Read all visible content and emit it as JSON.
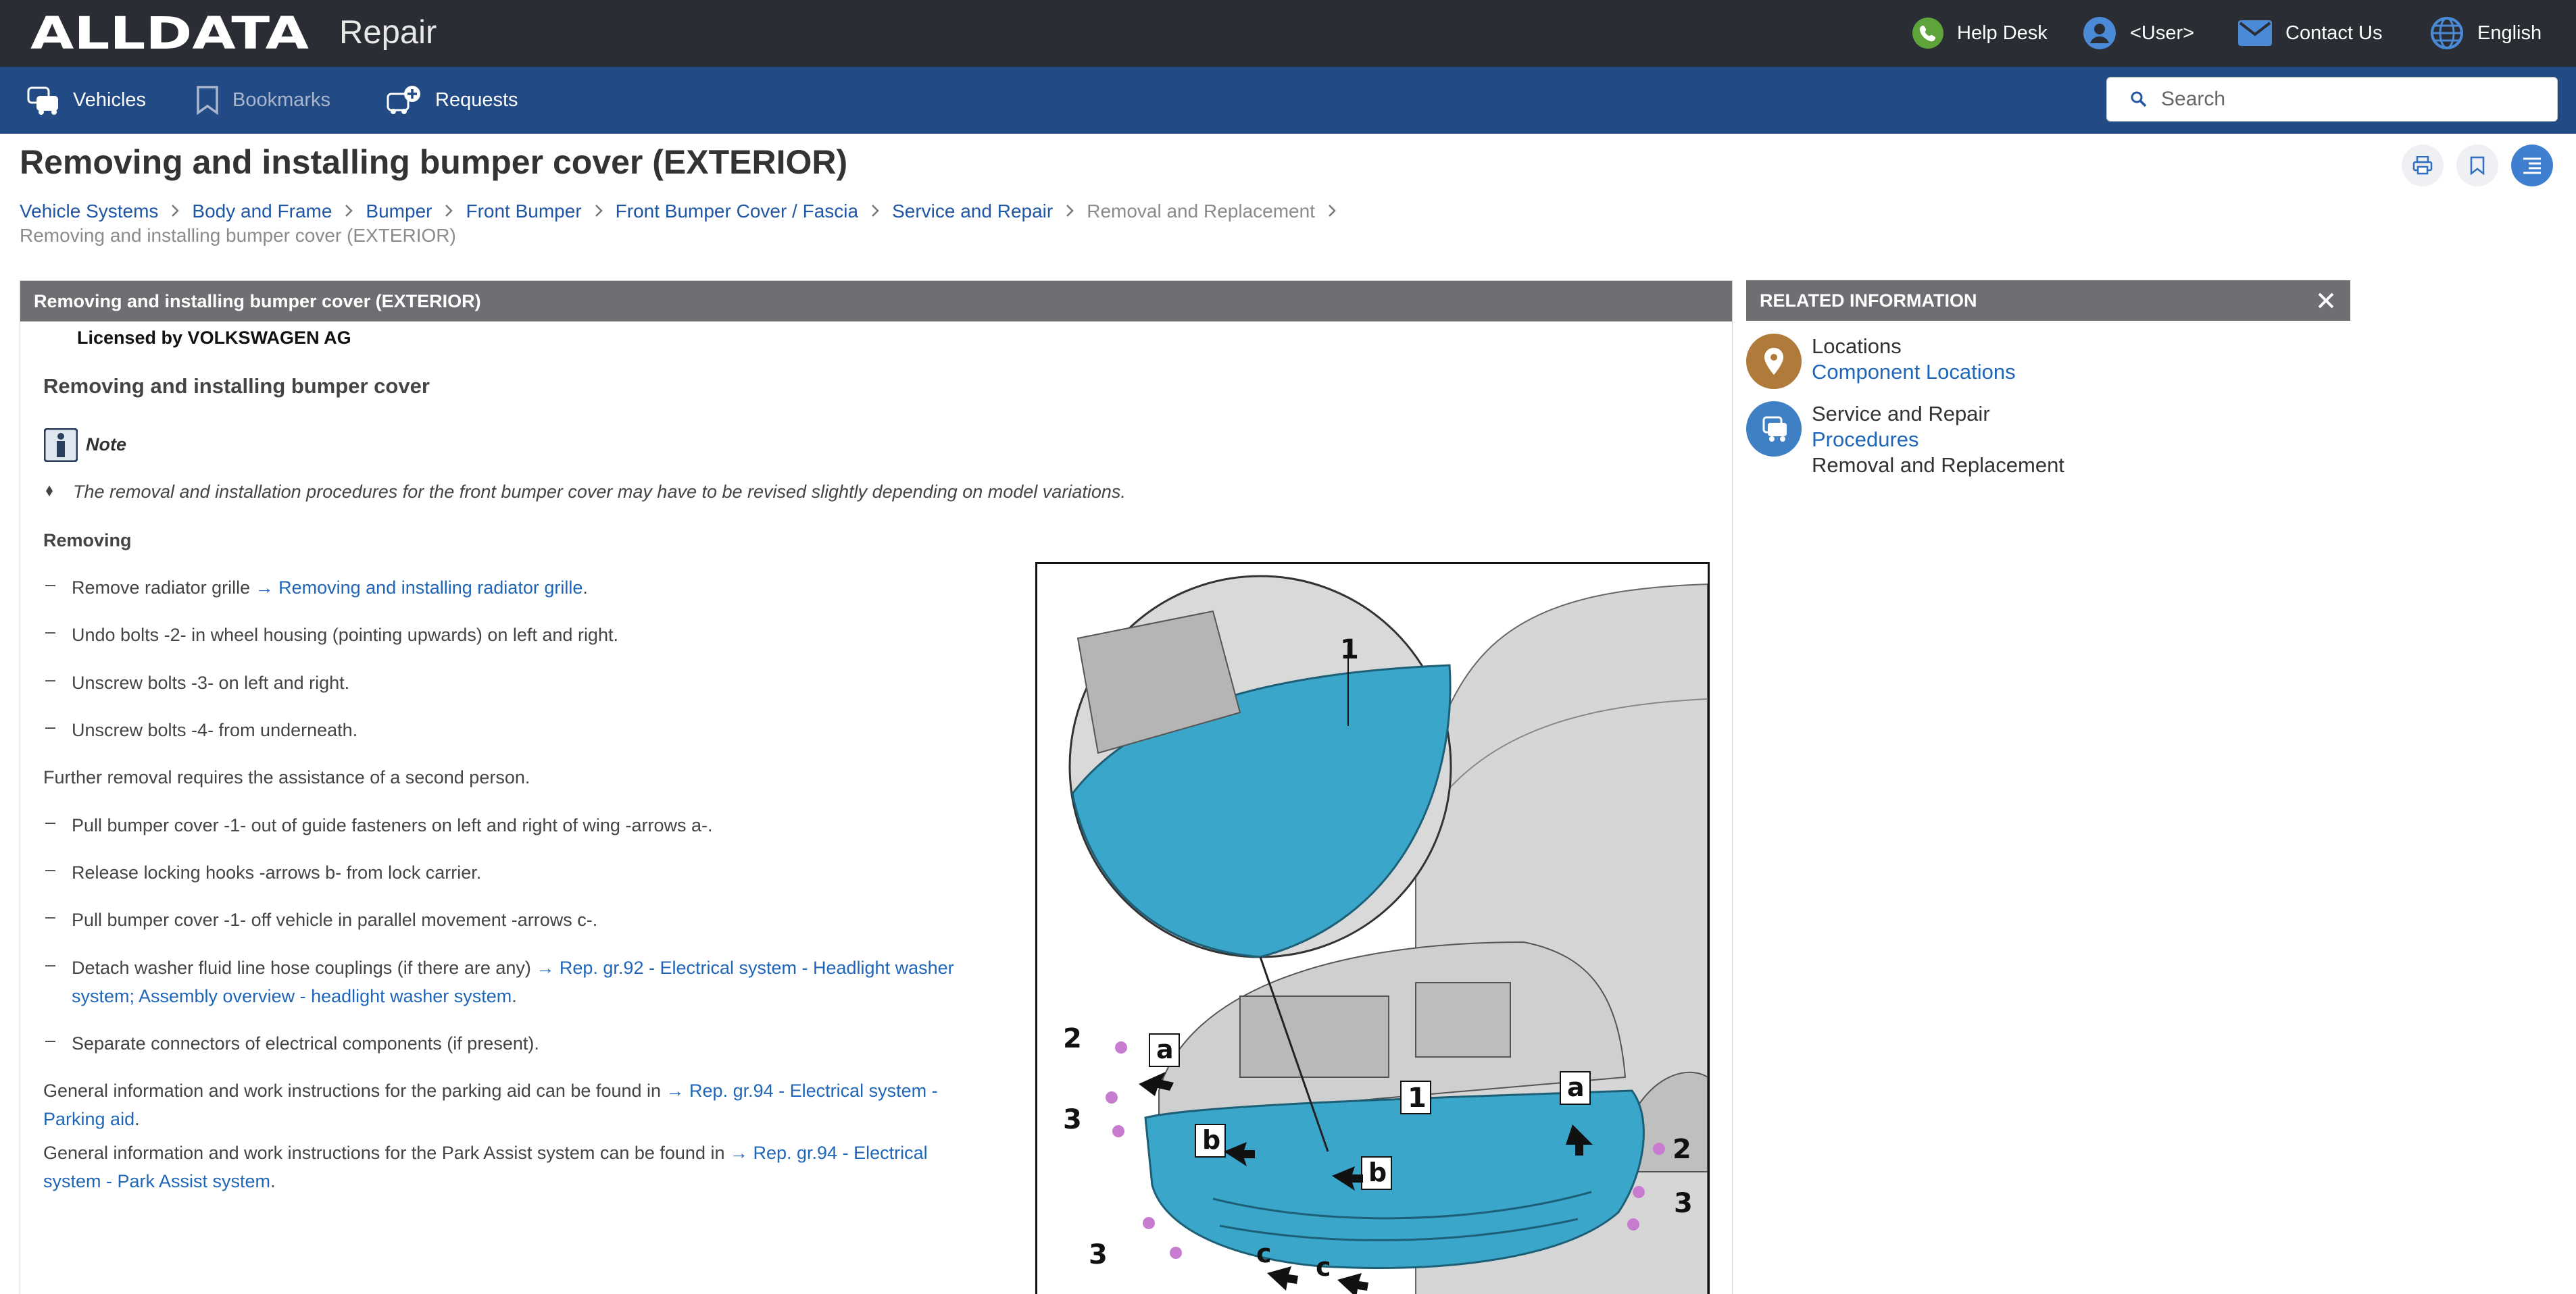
{
  "header": {
    "brand": "ALLDATA",
    "app_title": "Repair",
    "help_desk": "Help Desk",
    "user": "<User>",
    "contact": "Contact Us",
    "language": "English"
  },
  "nav": {
    "vehicles": "Vehicles",
    "bookmarks": "Bookmarks",
    "requests": "Requests",
    "search_placeholder": "Search"
  },
  "page": {
    "title": "Removing and installing bumper cover (EXTERIOR)"
  },
  "breadcrumb": [
    {
      "label": "Vehicle Systems"
    },
    {
      "label": "Body and Frame"
    },
    {
      "label": "Bumper"
    },
    {
      "label": "Front Bumper"
    },
    {
      "label": "Front Bumper Cover / Fascia"
    },
    {
      "label": "Service and Repair"
    },
    {
      "label": "Removal and Replacement"
    }
  ],
  "breadcrumb_current": "Removing and installing bumper cover (EXTERIOR)",
  "article": {
    "header": "Removing and installing bumper cover (EXTERIOR)",
    "license": "Licensed by VOLKSWAGEN AG",
    "heading": "Removing and installing bumper cover",
    "note_label": "Note",
    "note_text": "The removal and installation procedures for the front bumper cover may have to be revised slightly depending on model variations.",
    "removing_label": "Removing",
    "step1_text": "Remove radiator grille ",
    "step1_link": "→ Removing and installing radiator grille",
    "step2": "Undo bolts -2- in wheel housing (pointing upwards) on left and right.",
    "step3": "Unscrew bolts -3- on left and right.",
    "step4": "Unscrew bolts -4- from underneath.",
    "further": "Further removal requires the assistance of a second person.",
    "step5": "Pull bumper cover -1- out of guide fasteners on left and right of wing -arrows a-.",
    "step6": "Release locking hooks -arrows b- from lock carrier.",
    "step7": "Pull bumper cover -1- off vehicle in parallel movement -arrows c-.",
    "step8_text": "Detach washer fluid line hose couplings (if there are any) ",
    "step8_link_a": "→ Rep. gr.92 - Electrical system - Headlight washer",
    "step8_link_b": "system; Assembly overview - headlight washer system",
    "step9": "Separate connectors of electrical components (if present).",
    "park1_text": "General information and work instructions for the parking aid can be found in ",
    "park1_link_a": "→ Rep. gr.94 - Electrical system -",
    "park1_link_b": "Parking aid",
    "park2_text": "General information and work instructions for the Park Assist system can be found in ",
    "park2_link_a": "→ Rep. gr.94 - Electrical",
    "park2_link_b": "system - Park Assist system",
    "period": "."
  },
  "figure_labels": {
    "l1": "1",
    "l2": "2",
    "l3": "3",
    "a": "a",
    "b": "b",
    "c": "c"
  },
  "related": {
    "title": "RELATED INFORMATION",
    "locations_label": "Locations",
    "locations_link": "Component Locations",
    "service_label": "Service and Repair",
    "service_link": "Procedures",
    "service_sub": "Removal and Replacement"
  },
  "colors": {
    "topbar": "#2a2d34",
    "navbar": "#224a85",
    "link": "#1f66b8",
    "panel_header": "#6e6f72",
    "bumper": "#3aa6c9",
    "locations_icon": "#b07a3a",
    "service_icon": "#3f7fc4"
  }
}
